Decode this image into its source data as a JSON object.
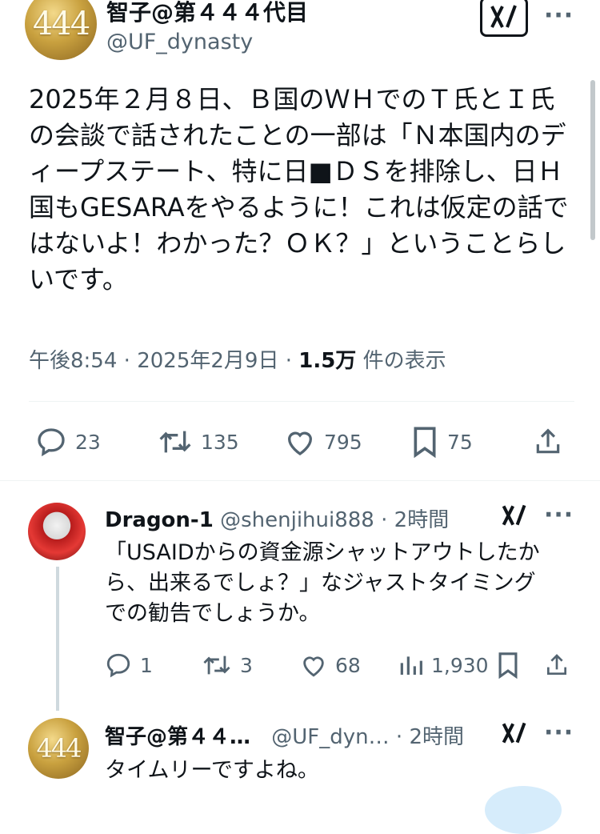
{
  "main_tweet": {
    "avatar_text": "444",
    "name": "智子@第４４４代目",
    "handle": "@UF_dynasty",
    "text": "2025年２月８日、Ｂ国のＷＨでのＴ氏とＩ氏\nの会談で話されたことの一部は「Ｎ本国内のデ\nィープステート、特に日■ＤＳを排除し、日Ｈ\n国もGESARAをやるように！これは仮定の話で\nはないよ！わかった？ＯＫ？」ということらし\nいです。",
    "time": "午後8:54",
    "date": "2025年2月9日",
    "views_count": "1.5万",
    "views_label": "件の表示",
    "actions": {
      "replies": "23",
      "retweets": "135",
      "likes": "795",
      "bookmarks": "75"
    }
  },
  "reply1": {
    "name": "Dragon-1",
    "handle": "@shenjihui888",
    "time": "2時間",
    "text": "「USAIDからの資金源シャットアウトしたか\nら、出来るでしょ？」なジャストタイミング\nでの勧告でしょうか。",
    "actions": {
      "replies": "1",
      "retweets": "3",
      "likes": "68",
      "views": "1,930"
    }
  },
  "reply2": {
    "avatar_text": "444",
    "name": "智子@第４４…",
    "handle": "@UF_dyn…",
    "time": "2時間",
    "text": "タイムリーですよね。"
  },
  "separator": "·",
  "colors": {
    "text": "#0f1419",
    "muted": "#536471",
    "divider": "#eff3f4",
    "avatar_gold": "#c9a13f"
  },
  "icons": [
    "grok-icon",
    "more-icon",
    "reply-icon",
    "retweet-icon",
    "like-icon",
    "bookmark-icon",
    "share-icon",
    "views-icon"
  ]
}
